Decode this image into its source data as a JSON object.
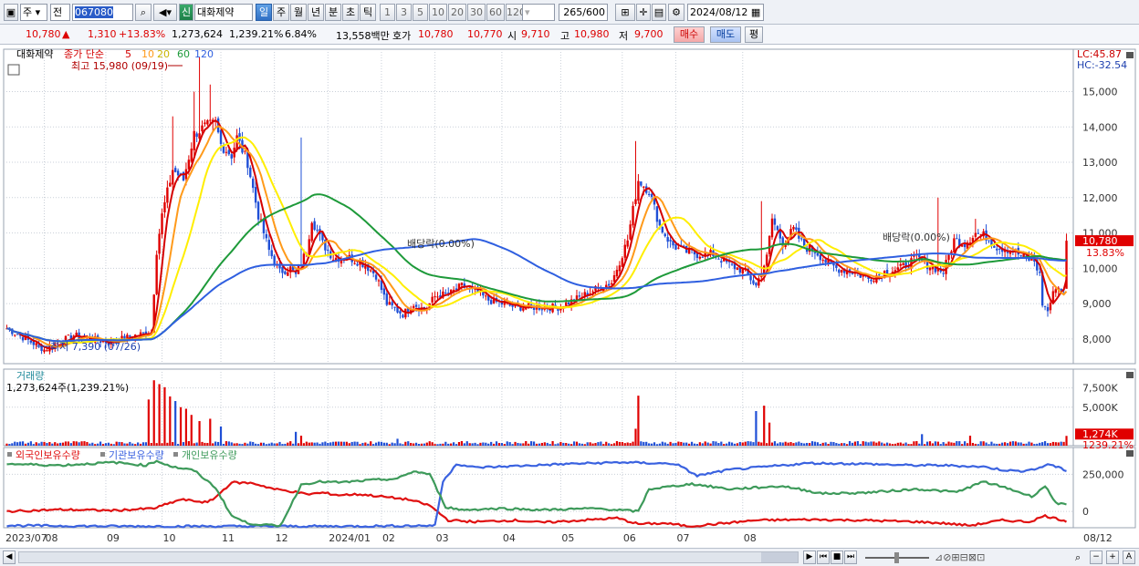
{
  "toolbar": {
    "market": "주",
    "prev": "전",
    "code": "067080",
    "name_badge": "신",
    "name": "대화제약",
    "periods": [
      "일",
      "주",
      "월",
      "년",
      "분",
      "초",
      "틱"
    ],
    "active_period": "일",
    "minutes": [
      "1",
      "3",
      "5",
      "10",
      "20",
      "30",
      "60",
      "120"
    ],
    "count": "265",
    "count_total": "/600",
    "date": "2024/08/12"
  },
  "quote": {
    "price": "10,780",
    "arrow": "▲",
    "change": "1,310",
    "change_pct": "+13.83%",
    "volume": "1,273,624",
    "volume_pct": "1,239.21%",
    "turnover_pct": "6.84%",
    "amount": "13,558백만",
    "bid_label": "호가",
    "bid1": "10,780",
    "bid2": "10,770",
    "open_label": "시",
    "open": "9,710",
    "high_label": "고",
    "high": "10,980",
    "low_label": "저",
    "low": "9,700",
    "buy_label": "매수",
    "sell_label": "매도",
    "eval_label": "평"
  },
  "colors": {
    "up": "#e00000",
    "down": "#1f4fd6",
    "ma5": "#d40000",
    "ma10": "#ff9a1a",
    "ma20": "#ffee00",
    "ma60": "#1e9a3a",
    "ma120": "#2f5fe0",
    "foreign": "#e01010",
    "inst": "#3a62e0",
    "indiv": "#3d9a5a"
  },
  "chart_data": [
    {
      "type": "candlestick",
      "panel": "price",
      "legend_stock": "대화제약",
      "legend_label": "종가 단순",
      "ma_periods": [
        "5",
        "10",
        "20",
        "60",
        "120"
      ],
      "y_ticks": [
        8000,
        9000,
        10000,
        11000,
        12000,
        13000,
        14000,
        15000
      ],
      "y_tick_labels": [
        "8,000",
        "9,000",
        "10,000",
        "11,000",
        "12,000",
        "13,000",
        "14,000",
        "15,000"
      ],
      "ylim": [
        7300,
        16200
      ],
      "lc_label": "LC:45.87",
      "hc_label": "HC:-32.54",
      "x_labels": [
        "2023/07",
        "08",
        "09",
        "10",
        "11",
        "12",
        "2024/01",
        "02",
        "03",
        "04",
        "05",
        "06",
        "07",
        "08",
        "08/12"
      ],
      "high_annotation": "최고 15,980 (09/19)",
      "low_annotation": "최저 7,390 (07/26)",
      "dividend_annotation_1": "배당락(0.00%)",
      "dividend_annotation_2": "배당락(0.00%)",
      "last_price_label": "10,780",
      "last_pct_label": "13.83%",
      "close_anchors": [
        [
          0,
          8300
        ],
        [
          14,
          7700
        ],
        [
          25,
          8100
        ],
        [
          38,
          7900
        ],
        [
          48,
          8100
        ],
        [
          54,
          8200
        ],
        [
          56,
          10500
        ],
        [
          58,
          11500
        ],
        [
          62,
          12800
        ],
        [
          66,
          12500
        ],
        [
          70,
          13800
        ],
        [
          74,
          14000
        ],
        [
          78,
          14100
        ],
        [
          80,
          13500
        ],
        [
          84,
          13200
        ],
        [
          86,
          13700
        ],
        [
          90,
          13000
        ],
        [
          94,
          11500
        ],
        [
          98,
          10500
        ],
        [
          102,
          9900
        ],
        [
          106,
          10000
        ],
        [
          108,
          9800
        ],
        [
          112,
          10500
        ],
        [
          114,
          11400
        ],
        [
          118,
          10700
        ],
        [
          122,
          10300
        ],
        [
          128,
          10300
        ],
        [
          134,
          10100
        ],
        [
          138,
          9800
        ],
        [
          142,
          9000
        ],
        [
          148,
          8700
        ],
        [
          152,
          9000
        ],
        [
          156,
          8800
        ],
        [
          160,
          9200
        ],
        [
          166,
          9300
        ],
        [
          170,
          9500
        ],
        [
          176,
          9300
        ],
        [
          180,
          9100
        ],
        [
          190,
          8900
        ],
        [
          200,
          8900
        ],
        [
          206,
          8900
        ],
        [
          212,
          9100
        ],
        [
          220,
          9400
        ],
        [
          226,
          9600
        ],
        [
          232,
          10800
        ],
        [
          236,
          12500
        ],
        [
          240,
          12200
        ],
        [
          244,
          11200
        ],
        [
          248,
          10700
        ],
        [
          252,
          10500
        ],
        [
          258,
          10400
        ],
        [
          264,
          10400
        ],
        [
          270,
          10100
        ],
        [
          276,
          9900
        ],
        [
          280,
          9500
        ],
        [
          284,
          10300
        ],
        [
          286,
          11400
        ],
        [
          290,
          10700
        ],
        [
          294,
          11100
        ],
        [
          298,
          10600
        ],
        [
          302,
          10500
        ],
        [
          306,
          10200
        ],
        [
          310,
          10000
        ],
        [
          316,
          9900
        ],
        [
          322,
          9700
        ],
        [
          328,
          9900
        ],
        [
          334,
          10000
        ],
        [
          340,
          10300
        ],
        [
          344,
          10100
        ],
        [
          350,
          9900
        ],
        [
          354,
          10800
        ],
        [
          358,
          10700
        ],
        [
          362,
          11000
        ],
        [
          366,
          10900
        ],
        [
          370,
          10600
        ],
        [
          376,
          10500
        ],
        [
          380,
          10300
        ],
        [
          384,
          10200
        ],
        [
          386,
          9800
        ],
        [
          387,
          9000
        ],
        [
          389,
          8800
        ],
        [
          392,
          9500
        ],
        [
          394,
          9400
        ],
        [
          395,
          9470
        ],
        [
          396,
          10780
        ]
      ],
      "spike_days": [
        [
          62,
          14300
        ],
        [
          70,
          15000
        ],
        [
          72,
          15980
        ],
        [
          76,
          15200
        ],
        [
          110,
          13700
        ],
        [
          235,
          13600
        ],
        [
          282,
          11900
        ],
        [
          348,
          12000
        ],
        [
          362,
          11400
        ]
      ]
    },
    {
      "type": "bar",
      "panel": "volume",
      "title": "거래량",
      "value_label": "1,273,624주(1,239.21%)",
      "y_ticks": [
        5000,
        7500
      ],
      "y_tick_labels": [
        "5,000K",
        "7,500K"
      ],
      "last_label": "1,274K",
      "last_pct_label": "1239.21%",
      "ylim": [
        0,
        9000
      ],
      "spikes_k": [
        [
          53,
          6000
        ],
        [
          55,
          8500
        ],
        [
          57,
          8000
        ],
        [
          59,
          7600
        ],
        [
          61,
          6400
        ],
        [
          63,
          5800
        ],
        [
          65,
          5000
        ],
        [
          67,
          4800
        ],
        [
          69,
          4000
        ],
        [
          72,
          3200
        ],
        [
          76,
          3500
        ],
        [
          80,
          2500
        ],
        [
          108,
          1800
        ],
        [
          110,
          1300
        ],
        [
          146,
          900
        ],
        [
          236,
          6500
        ],
        [
          235,
          2200
        ],
        [
          280,
          4500
        ],
        [
          283,
          5200
        ],
        [
          285,
          3000
        ],
        [
          342,
          1500
        ],
        [
          360,
          1300
        ],
        [
          396,
          1274
        ]
      ],
      "base_k": 500
    },
    {
      "type": "line",
      "panel": "holdings",
      "series": [
        {
          "name": "외국인보유수량",
          "color": "#e01010",
          "anchors": [
            [
              0,
              0
            ],
            [
              20,
              12000
            ],
            [
              40,
              6000
            ],
            [
              55,
              20000
            ],
            [
              65,
              80000
            ],
            [
              75,
              60000
            ],
            [
              78,
              95000
            ],
            [
              84,
              195000
            ],
            [
              92,
              190000
            ],
            [
              100,
              150000
            ],
            [
              108,
              130000
            ],
            [
              112,
              115000
            ],
            [
              118,
              125000
            ],
            [
              124,
              110000
            ],
            [
              132,
              115000
            ],
            [
              140,
              100000
            ],
            [
              150,
              80000
            ],
            [
              158,
              40000
            ],
            [
              165,
              -60000
            ],
            [
              175,
              -70000
            ],
            [
              190,
              -60000
            ],
            [
              200,
              -75000
            ],
            [
              215,
              -60000
            ],
            [
              228,
              -45000
            ],
            [
              236,
              -85000
            ],
            [
              246,
              -80000
            ],
            [
              255,
              -100000
            ],
            [
              265,
              -85000
            ],
            [
              280,
              -60000
            ],
            [
              300,
              -55000
            ],
            [
              320,
              -60000
            ],
            [
              340,
              -70000
            ],
            [
              350,
              -80000
            ],
            [
              360,
              -95000
            ],
            [
              372,
              -60000
            ],
            [
              382,
              -70000
            ],
            [
              388,
              -30000
            ],
            [
              396,
              -65000
            ]
          ]
        },
        {
          "name": "기관보유수량",
          "color": "#3a62e0",
          "anchors": [
            [
              0,
              -95000
            ],
            [
              40,
              -100000
            ],
            [
              80,
              -100000
            ],
            [
              100,
              -100000
            ],
            [
              130,
              -100000
            ],
            [
              160,
              -95000
            ],
            [
              163,
              200000
            ],
            [
              168,
              320000
            ],
            [
              175,
              295000
            ],
            [
              190,
              305000
            ],
            [
              210,
              320000
            ],
            [
              230,
              330000
            ],
            [
              250,
              320000
            ],
            [
              258,
              240000
            ],
            [
              270,
              280000
            ],
            [
              300,
              325000
            ],
            [
              320,
              320000
            ],
            [
              338,
              310000
            ],
            [
              350,
              310000
            ],
            [
              365,
              300000
            ],
            [
              372,
              280000
            ],
            [
              378,
              270000
            ],
            [
              386,
              290000
            ],
            [
              389,
              320000
            ],
            [
              396,
              275000
            ]
          ]
        },
        {
          "name": "개인보유수량",
          "color": "#3d9a5a",
          "anchors": [
            [
              0,
              320000
            ],
            [
              20,
              310000
            ],
            [
              40,
              330000
            ],
            [
              52,
              310000
            ],
            [
              56,
              340000
            ],
            [
              62,
              300000
            ],
            [
              70,
              275000
            ],
            [
              78,
              160000
            ],
            [
              84,
              -30000
            ],
            [
              90,
              -80000
            ],
            [
              102,
              -100000
            ],
            [
              105,
              0
            ],
            [
              110,
              180000
            ],
            [
              116,
              200000
            ],
            [
              125,
              195000
            ],
            [
              136,
              210000
            ],
            [
              146,
              220000
            ],
            [
              152,
              270000
            ],
            [
              158,
              250000
            ],
            [
              164,
              30000
            ],
            [
              170,
              10000
            ],
            [
              185,
              20000
            ],
            [
              200,
              10000
            ],
            [
              220,
              20000
            ],
            [
              236,
              0
            ],
            [
              240,
              150000
            ],
            [
              256,
              185000
            ],
            [
              270,
              150000
            ],
            [
              290,
              170000
            ],
            [
              305,
              120000
            ],
            [
              320,
              125000
            ],
            [
              340,
              150000
            ],
            [
              355,
              130000
            ],
            [
              365,
              200000
            ],
            [
              375,
              150000
            ],
            [
              383,
              100000
            ],
            [
              388,
              170000
            ],
            [
              392,
              60000
            ],
            [
              396,
              40000
            ]
          ]
        }
      ],
      "y_ticks": [
        0,
        250000
      ],
      "y_tick_labels": [
        "0",
        "250,000"
      ],
      "ylim": [
        -110000,
        430000
      ]
    }
  ],
  "scrollbar": {
    "left": "◀",
    "right": "▶",
    "first": "⏮",
    "stop": "■",
    "last": "⏭",
    "zoom_out": "−",
    "zoom_in": "+",
    "font": "A"
  }
}
